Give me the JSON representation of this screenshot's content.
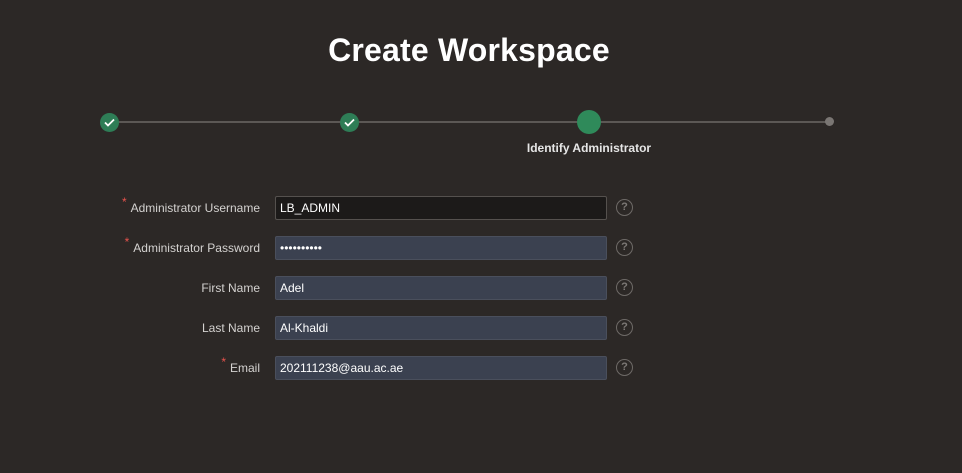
{
  "page": {
    "title": "Create Workspace"
  },
  "train": {
    "current_step_label": "Identify Administrator",
    "steps": [
      {
        "state": "complete"
      },
      {
        "state": "complete"
      },
      {
        "state": "current",
        "label": "Identify Administrator"
      },
      {
        "state": "future"
      }
    ]
  },
  "form": {
    "fields": [
      {
        "label": "Administrator Username",
        "required": true,
        "value": "LB_ADMIN",
        "help": "?"
      },
      {
        "label": "Administrator Password",
        "required": true,
        "value": "••••••••••",
        "help": "?"
      },
      {
        "label": "First Name",
        "required": false,
        "value": "Adel",
        "help": "?"
      },
      {
        "label": "Last Name",
        "required": false,
        "value": "Al-Khaldi",
        "help": "?"
      },
      {
        "label": "Email",
        "required": true,
        "value": "202111238@aau.ac.ae",
        "help": "?"
      }
    ],
    "required_marker": "*"
  },
  "colors": {
    "background": "#2c2826",
    "complete_step": "#2e7d56",
    "field_bg": "#3b4150",
    "required": "#e8534d"
  }
}
